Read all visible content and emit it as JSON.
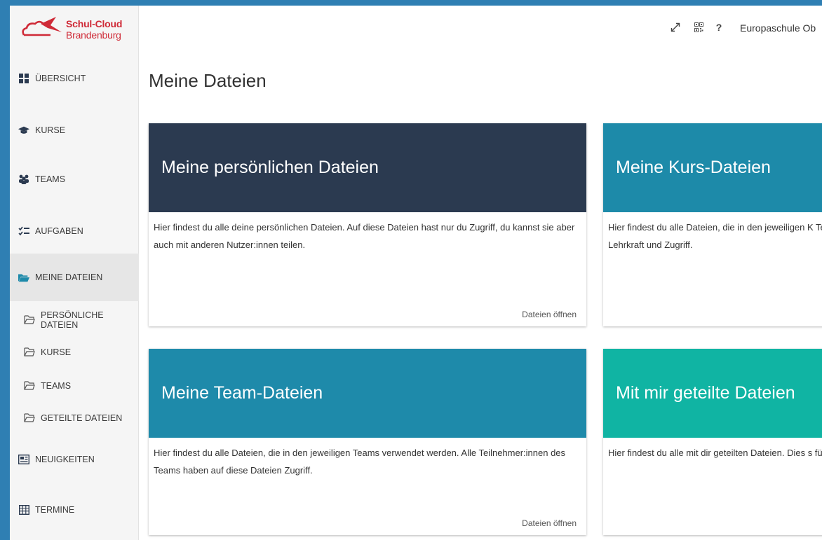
{
  "logo": {
    "line1": "Schul-Cloud",
    "line2": "Brandenburg"
  },
  "sidebar": {
    "items": [
      {
        "label": "ÜBERSICHT",
        "icon": "dashboard-icon"
      },
      {
        "label": "KURSE",
        "icon": "graduation-cap-icon"
      },
      {
        "label": "TEAMS",
        "icon": "users-icon"
      },
      {
        "label": "AUFGABEN",
        "icon": "tasks-icon"
      },
      {
        "label": "MEINE DATEIEN",
        "icon": "folder-open-icon",
        "active": true
      },
      {
        "label": "NEUIGKEITEN",
        "icon": "newspaper-icon"
      },
      {
        "label": "TERMINE",
        "icon": "calendar-icon"
      }
    ],
    "subitems": [
      {
        "label": "PERSÖNLICHE DATEIEN",
        "icon": "folder-icon"
      },
      {
        "label": "KURSE",
        "icon": "folder-icon"
      },
      {
        "label": "TEAMS",
        "icon": "folder-icon"
      },
      {
        "label": "GETEILTE DATEIEN",
        "icon": "folder-icon"
      }
    ]
  },
  "topbar": {
    "icons": [
      "fullscreen-icon",
      "qr-code-icon",
      "help-icon"
    ],
    "help_glyph": "?",
    "school": "Europaschule Ob"
  },
  "page": {
    "title": "Meine Dateien"
  },
  "cards": [
    {
      "title": "Meine persönlichen Dateien",
      "desc": "Hier findest du alle deine persönlichen Dateien. Auf diese Dateien hast nur du Zugriff, du kannst sie aber auch mit anderen Nutzer:innen teilen.",
      "link": "Dateien öffnen",
      "color": "#2b3a50"
    },
    {
      "title": "Meine Kurs-Dateien",
      "desc": "Hier findest du alle Dateien, die in den jeweiligen K Teilnehmer:innen des Kurses, also die Lehrkraft und Zugriff.",
      "link": "",
      "color": "#1d8aa9"
    },
    {
      "title": "Meine Team-Dateien",
      "desc": "Hier findest du alle Dateien, die in den jeweiligen Teams verwendet werden. Alle Teilnehmer:innen des Teams haben auf diese Dateien Zugriff.",
      "link": "Dateien öffnen",
      "color": "#1e8aaa"
    },
    {
      "title": "Mit mir geteilte Dateien",
      "desc": "Hier findest du alle mit dir geteilten Dateien. Dies s fügung gestellt worden sind.",
      "link": "",
      "color": "#10b4a3"
    }
  ]
}
